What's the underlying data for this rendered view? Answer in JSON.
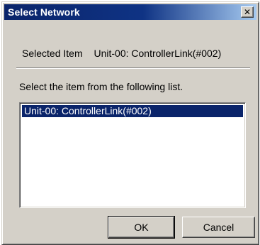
{
  "window": {
    "title": "Select Network",
    "close_glyph": "✕"
  },
  "selected": {
    "label": "Selected Item",
    "value": "Unit-00: ControllerLink(#002)"
  },
  "prompt": "Select the item from the following list.",
  "list": {
    "items": [
      {
        "label": "Unit-00: ControllerLink(#002)",
        "selected": true
      }
    ]
  },
  "buttons": {
    "ok": "OK",
    "cancel": "Cancel"
  },
  "colors": {
    "titlebar": "#0a246a",
    "face": "#d4d0c8",
    "selection": "#0a246a"
  }
}
